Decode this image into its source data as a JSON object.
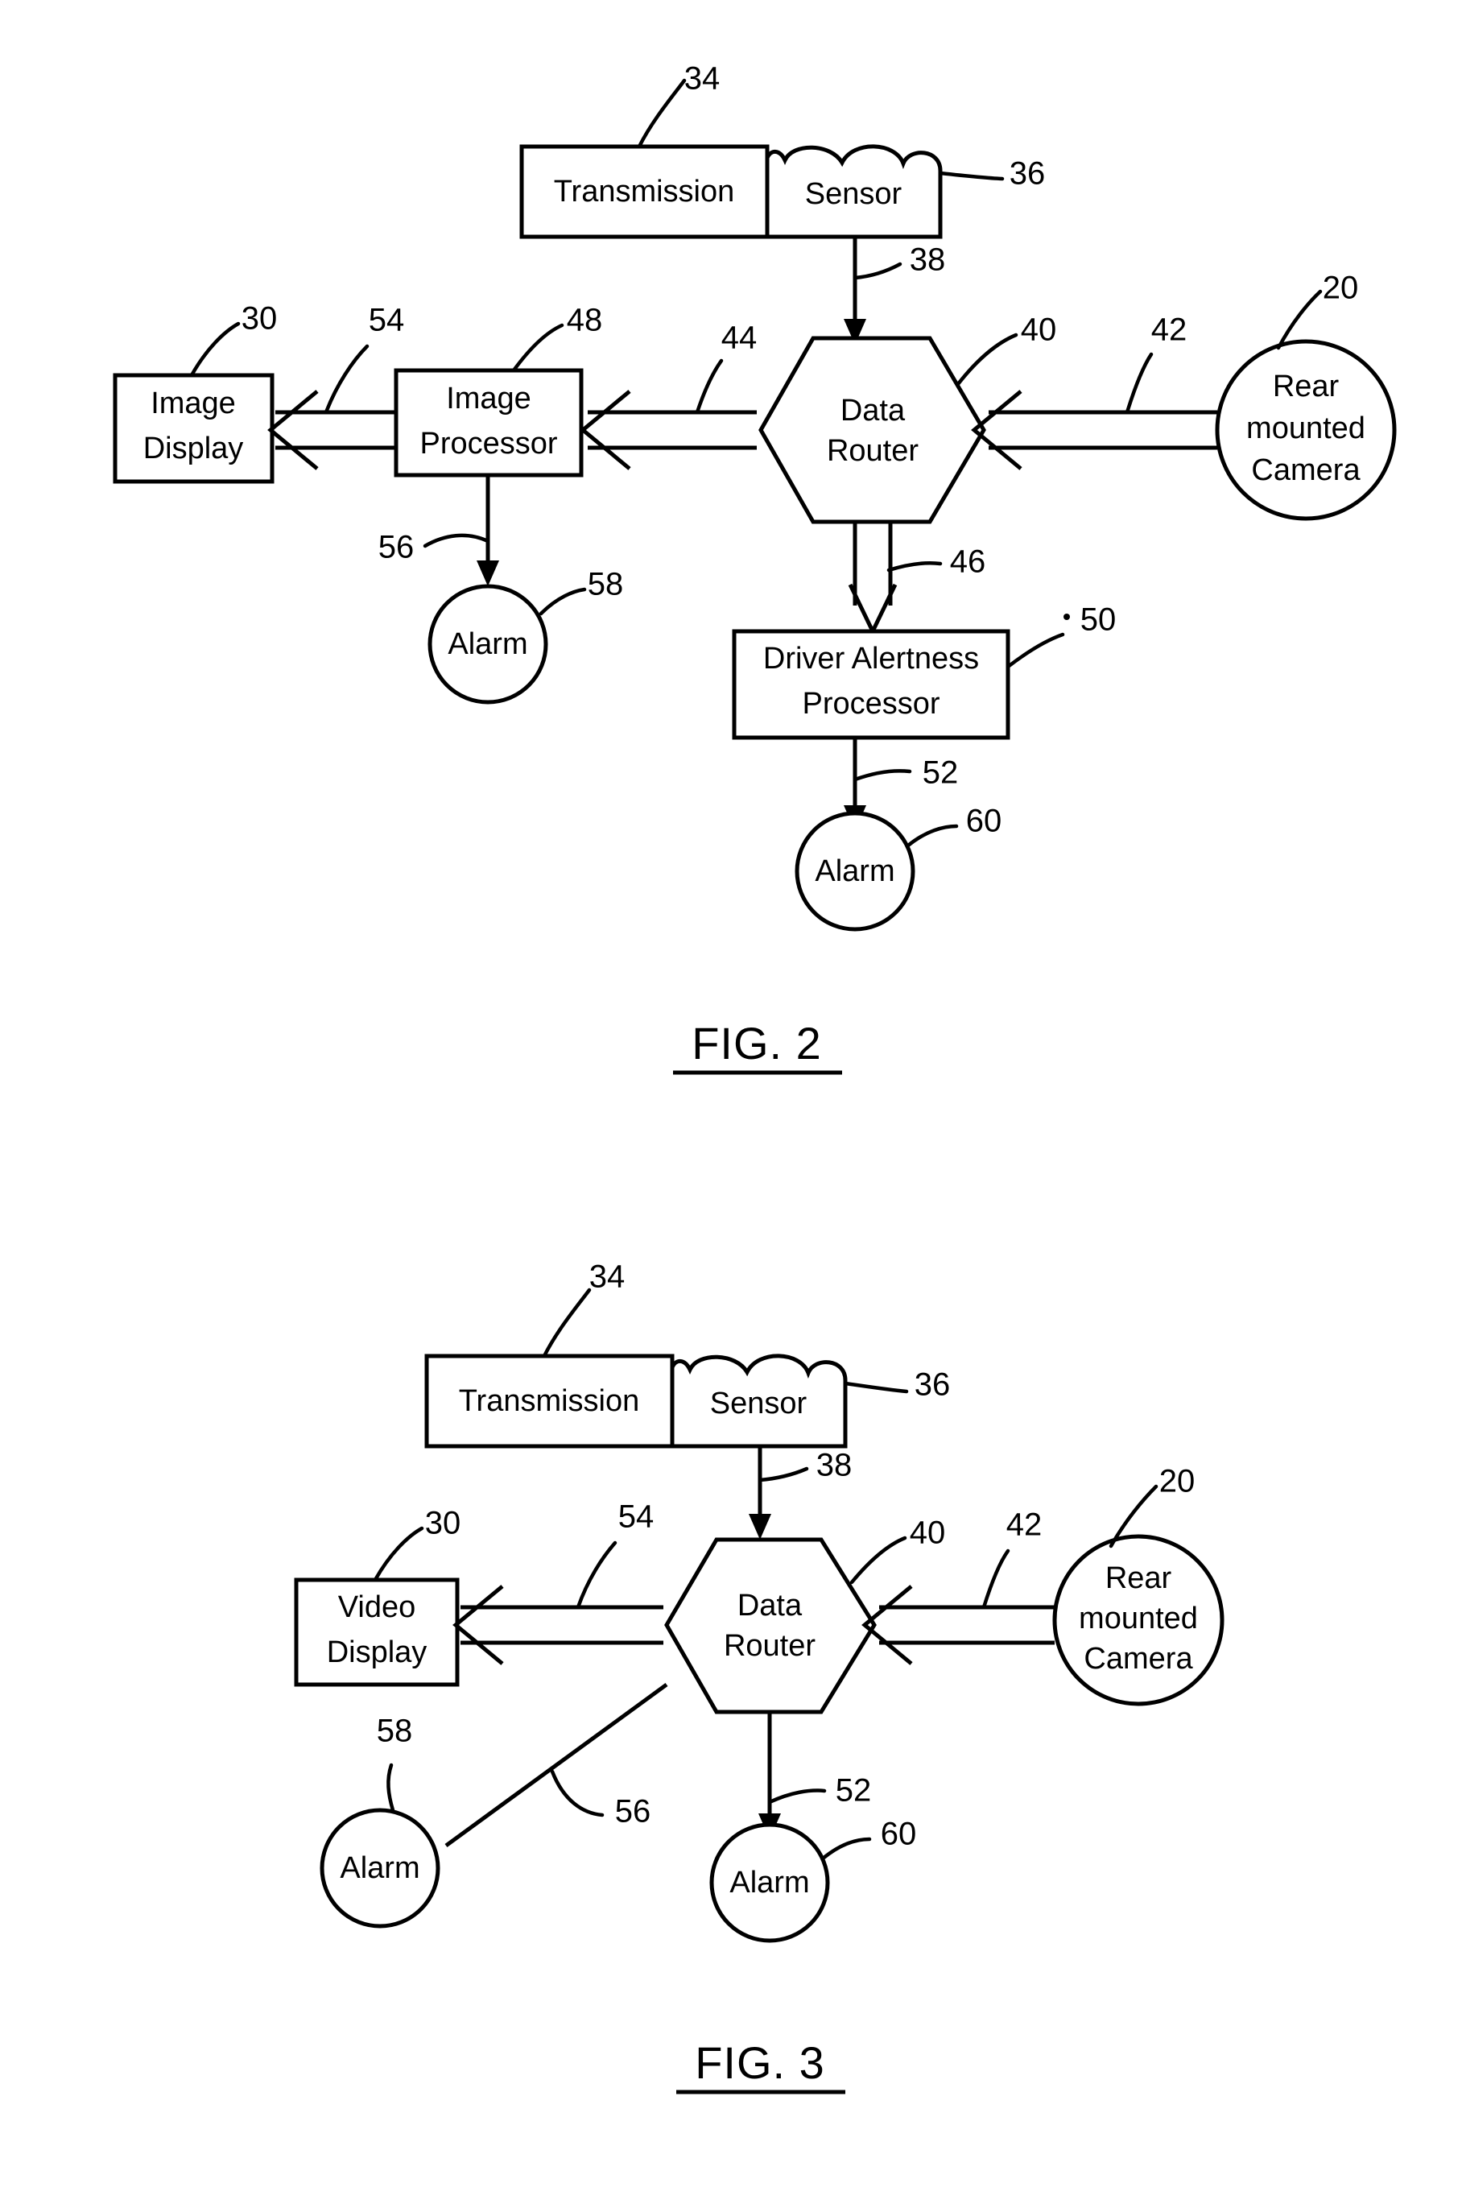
{
  "document": {
    "type": "patent-drawing-sheet",
    "figures": [
      {
        "id": "fig2",
        "caption": "FIG. 2",
        "nodes": [
          {
            "key": "transmission",
            "label": "Transmission",
            "shape": "rectangle",
            "ref": "34"
          },
          {
            "key": "sensor",
            "label": "Sensor",
            "shape": "cloud-top-box",
            "ref": "36"
          },
          {
            "key": "data_router",
            "label_line1": "Data",
            "label_line2": "Router",
            "shape": "hexagon",
            "ref": "40"
          },
          {
            "key": "image_processor",
            "label_line1": "Image",
            "label_line2": "Processor",
            "shape": "rectangle",
            "ref": "48"
          },
          {
            "key": "image_display",
            "label_line1": "Image",
            "label_line2": "Display",
            "shape": "rectangle",
            "ref": "30"
          },
          {
            "key": "rear_camera",
            "label_line1": "Rear",
            "label_line2": "mounted",
            "label_line3": "Camera",
            "shape": "circle",
            "ref": "20"
          },
          {
            "key": "driver_alertness",
            "label_line1": "Driver Alertness",
            "label_line2": "Processor",
            "shape": "rectangle",
            "ref": "50"
          },
          {
            "key": "alarm_left",
            "label": "Alarm",
            "shape": "circle",
            "ref": "58"
          },
          {
            "key": "alarm_bottom",
            "label": "Alarm",
            "shape": "circle",
            "ref": "60"
          }
        ],
        "connections": [
          {
            "key": "sensor_to_router",
            "ref": "38",
            "from": "sensor",
            "to": "data_router",
            "style": "single-line-solid-arrow"
          },
          {
            "key": "camera_to_router",
            "ref": "42",
            "from": "rear_camera",
            "to": "data_router",
            "style": "double-line-open-arrow"
          },
          {
            "key": "router_to_processor",
            "ref": "44",
            "from": "data_router",
            "to": "image_processor",
            "style": "double-line-open-arrow"
          },
          {
            "key": "processor_to_display",
            "ref": "54",
            "from": "image_processor",
            "to": "image_display",
            "style": "double-line-open-arrow"
          },
          {
            "key": "processor_to_alarm",
            "ref": "56",
            "from": "image_processor",
            "to": "alarm_left",
            "style": "single-line-solid-arrow"
          },
          {
            "key": "router_to_alertness",
            "ref": "46",
            "from": "data_router",
            "to": "driver_alertness",
            "style": "double-line-open-arrow"
          },
          {
            "key": "alertness_to_alarm",
            "ref": "52",
            "from": "driver_alertness",
            "to": "alarm_bottom",
            "style": "single-line-solid-arrow"
          }
        ],
        "reference_numerals": [
          "34",
          "36",
          "38",
          "30",
          "54",
          "48",
          "44",
          "40",
          "42",
          "20",
          "56",
          "58",
          "46",
          "50",
          "52",
          "60"
        ]
      },
      {
        "id": "fig3",
        "caption": "FIG. 3",
        "nodes": [
          {
            "key": "transmission",
            "label": "Transmission",
            "shape": "rectangle",
            "ref": "34"
          },
          {
            "key": "sensor",
            "label": "Sensor",
            "shape": "cloud-top-box",
            "ref": "36"
          },
          {
            "key": "data_router",
            "label_line1": "Data",
            "label_line2": "Router",
            "shape": "hexagon",
            "ref": "40"
          },
          {
            "key": "video_display",
            "label_line1": "Video",
            "label_line2": "Display",
            "shape": "rectangle",
            "ref": "30"
          },
          {
            "key": "rear_camera",
            "label_line1": "Rear",
            "label_line2": "mounted",
            "label_line3": "Camera",
            "shape": "circle",
            "ref": "20"
          },
          {
            "key": "alarm_left",
            "label": "Alarm",
            "shape": "circle",
            "ref": "58"
          },
          {
            "key": "alarm_bottom",
            "label": "Alarm",
            "shape": "circle",
            "ref": "60"
          }
        ],
        "connections": [
          {
            "key": "sensor_to_router",
            "ref": "38",
            "from": "sensor",
            "to": "data_router",
            "style": "single-line-solid-arrow"
          },
          {
            "key": "camera_to_router",
            "ref": "42",
            "from": "rear_camera",
            "to": "data_router",
            "style": "double-line-open-arrow"
          },
          {
            "key": "router_to_display",
            "ref": "54",
            "from": "data_router",
            "to": "video_display",
            "style": "double-line-open-arrow"
          },
          {
            "key": "router_to_alarm_left",
            "ref": "56",
            "from": "data_router",
            "to": "alarm_left",
            "style": "plain-line"
          },
          {
            "key": "router_to_alarm_bottom",
            "ref": "52",
            "from": "data_router",
            "to": "alarm_bottom",
            "style": "single-line-solid-arrow"
          }
        ],
        "reference_numerals": [
          "34",
          "36",
          "38",
          "30",
          "54",
          "40",
          "42",
          "20",
          "58",
          "56",
          "52",
          "60"
        ]
      }
    ],
    "colors": {
      "ink": "#000000",
      "paper": "#ffffff"
    }
  }
}
